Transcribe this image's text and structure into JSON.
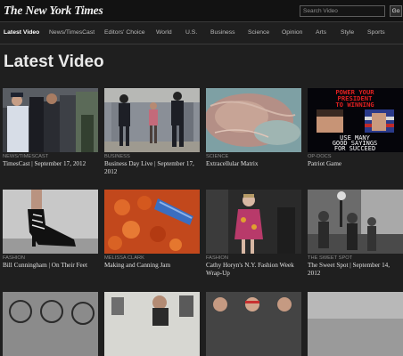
{
  "header": {
    "logo": "The New York Times",
    "search_placeholder": "Search Video",
    "go_label": "Go"
  },
  "nav": {
    "items": [
      "Latest Video",
      "News/TimesCast",
      "Editors' Choice",
      "World",
      "U.S.",
      "Business",
      "Science",
      "Opinion",
      "Arts",
      "Style",
      "Sports"
    ],
    "active": "Latest Video"
  },
  "page_title": "Latest Video",
  "videos": [
    {
      "category": "NEWS/TIMESCAST",
      "title": "TimesCast | September 17, 2012",
      "thumb": "police-protest-photo"
    },
    {
      "category": "BUSINESS",
      "title": "Business Day Live | September 17, 2012",
      "thumb": "police-in-hallway-photo"
    },
    {
      "category": "SCIENCE",
      "title": "Extracellular Matrix",
      "thumb": "tissue-closeup-photo"
    },
    {
      "category": "OP-DOCS",
      "title": "Patriot Game",
      "thumb": "pixel-game-screen",
      "thumb_text": [
        "POWER YOUR",
        "PRESIDENT",
        "TO WINNING",
        "USE MANY",
        "GOOD SAYINGS",
        "FOR SUCCEED"
      ]
    },
    {
      "category": "FASHION",
      "title": "Bill Cunningham | On Their Feet",
      "thumb": "high-heel-shoe-photo"
    },
    {
      "category": "MELISSA CLARK",
      "title": "Making and Canning Jam",
      "thumb": "jam-pot-photo"
    },
    {
      "category": "FASHION",
      "title": "Cathy Horyn's N.Y. Fashion Week Wrap-Up",
      "thumb": "runway-model-photo"
    },
    {
      "category": "THE SWEET SPOT",
      "title": "The Sweet Spot | September 14, 2012",
      "thumb": "street-crowd-photo"
    },
    {
      "category": "",
      "title": "",
      "thumb": "bicycles-photo"
    },
    {
      "category": "",
      "title": "",
      "thumb": "people-indoors-photo"
    },
    {
      "category": "",
      "title": "",
      "thumb": "runway-faces-photo"
    },
    {
      "category": "",
      "title": "",
      "thumb": "gray-photo"
    }
  ],
  "colors": {
    "background": "#1f1f1f",
    "header": "#121212",
    "game_title_red": "#e02020"
  }
}
